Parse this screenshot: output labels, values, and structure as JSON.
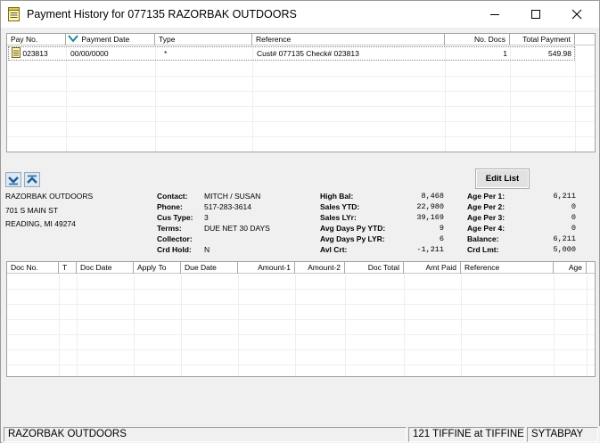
{
  "window": {
    "title": "Payment History for 077135 RAZORBAK OUTDOORS",
    "minimize_icon": "minimize-icon",
    "maximize_icon": "maximize-icon",
    "close_icon": "close-icon"
  },
  "payments": {
    "columns": {
      "pay_no": "Pay No.",
      "payment_date": "Payment Date",
      "type": "Type",
      "reference": "Reference",
      "no_docs": "No. Docs",
      "total_payment": "Total Payment"
    },
    "rows": [
      {
        "pay_no": "023813",
        "payment_date": "00/00/0000",
        "type": "*",
        "reference": "Cust# 077135  Check# 023813",
        "no_docs": "1",
        "total_payment": "549.98"
      }
    ]
  },
  "buttons": {
    "edit_list": "Edit List",
    "scroll_down_icon": "chevron-down-icon",
    "scroll_up_icon": "chevron-up-icon"
  },
  "customer": {
    "name": "RAZORBAK OUTDOORS",
    "address1": "701 S MAIN ST",
    "address2": "READING, MI 49274"
  },
  "contact": {
    "contact_label": "Contact:",
    "contact_value": "MITCH / SUSAN",
    "phone_label": "Phone:",
    "phone_value": "517-283-3614",
    "cus_type_label": "Cus Type:",
    "cus_type_value": "3",
    "terms_label": "Terms:",
    "terms_value": "DUE NET 30 DAYS",
    "collector_label": "Collector:",
    "collector_value": "",
    "crd_hold_label": "Crd Hold:",
    "crd_hold_value": "N"
  },
  "balances": {
    "high_bal_label": "High Bal:",
    "high_bal_value": "8,468",
    "sales_ytd_label": "Sales YTD:",
    "sales_ytd_value": "22,980",
    "sales_lyr_label": "Sales LYr:",
    "sales_lyr_value": "39,169",
    "avg_days_ytd_label": "Avg Days Py YTD:",
    "avg_days_ytd_value": "9",
    "avg_days_lyr_label": "Avg Days Py LYR:",
    "avg_days_lyr_value": "6",
    "avl_crt_label": "Avl Crt:",
    "avl_crt_value": "-1,211"
  },
  "aging": {
    "age_per1_label": "Age Per 1:",
    "age_per1_value": "6,211",
    "age_per2_label": "Age Per 2:",
    "age_per2_value": "0",
    "age_per3_label": "Age Per 3:",
    "age_per3_value": "0",
    "age_per4_label": "Age Per 4:",
    "age_per4_value": "0",
    "balance_label": "Balance:",
    "balance_value": "6,211",
    "crd_lmt_label": "Crd Lmt:",
    "crd_lmt_value": "5,000"
  },
  "documents": {
    "columns": {
      "doc_no": "Doc No.",
      "t": "T",
      "doc_date": "Doc Date",
      "apply_to": "Apply To",
      "due_date": "Due Date",
      "amount1": "Amount-1",
      "amount2": "Amount-2",
      "doc_total": "Doc Total",
      "amt_paid": "Amt Paid",
      "reference": "Reference",
      "age": "Age"
    }
  },
  "status_bar": {
    "customer": "RAZORBAK OUTDOORS",
    "location": "121 TIFFINE at TIFFINE",
    "user": "SYTABPAY"
  }
}
